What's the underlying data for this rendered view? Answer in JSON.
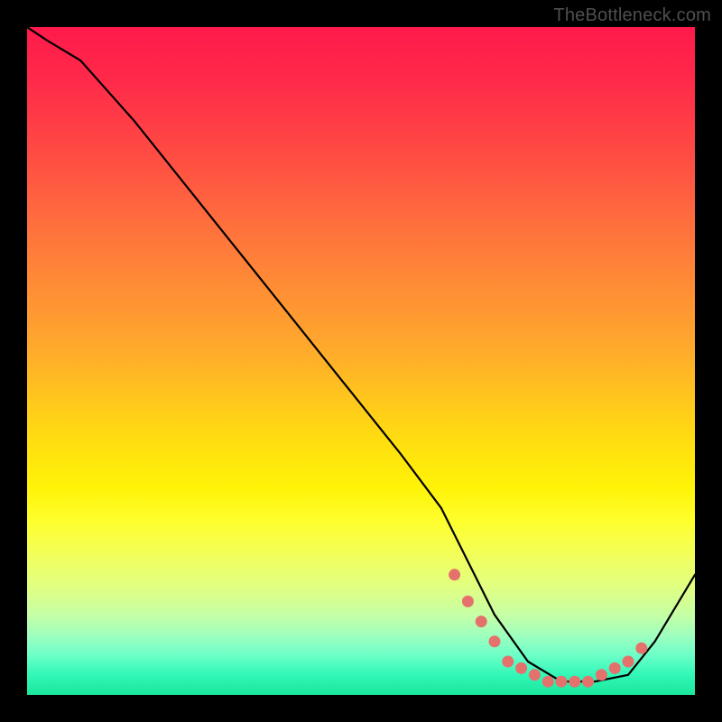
{
  "attribution": "TheBottleneck.com",
  "chart_data": {
    "type": "line",
    "title": "",
    "xlabel": "",
    "ylabel": "",
    "xlim": [
      0,
      100
    ],
    "ylim": [
      0,
      100
    ],
    "background": {
      "kind": "vertical-gradient",
      "top_color": "#ff1a4b",
      "mid_color": "#ffde10",
      "bottom_color": "#1be79b",
      "meaning": "red high → green low (bottleneck severity)"
    },
    "series": [
      {
        "name": "bottleneck-curve",
        "stroke": "#000000",
        "x": [
          0,
          3,
          8,
          16,
          24,
          32,
          40,
          48,
          56,
          62,
          66,
          70,
          75,
          80,
          85,
          90,
          94,
          100
        ],
        "values": [
          100,
          98,
          95,
          86,
          76,
          66,
          56,
          46,
          36,
          28,
          20,
          12,
          5,
          2,
          2,
          3,
          8,
          18
        ]
      }
    ],
    "markers": {
      "name": "optimum-band",
      "color": "#e5716d",
      "style": "dotted-thick",
      "x": [
        64,
        66,
        68,
        70,
        72,
        74,
        76,
        78,
        80,
        82,
        84,
        86,
        88,
        90,
        92
      ],
      "values": [
        18,
        14,
        11,
        8,
        5,
        4,
        3,
        2,
        2,
        2,
        2,
        3,
        4,
        5,
        7
      ]
    }
  }
}
